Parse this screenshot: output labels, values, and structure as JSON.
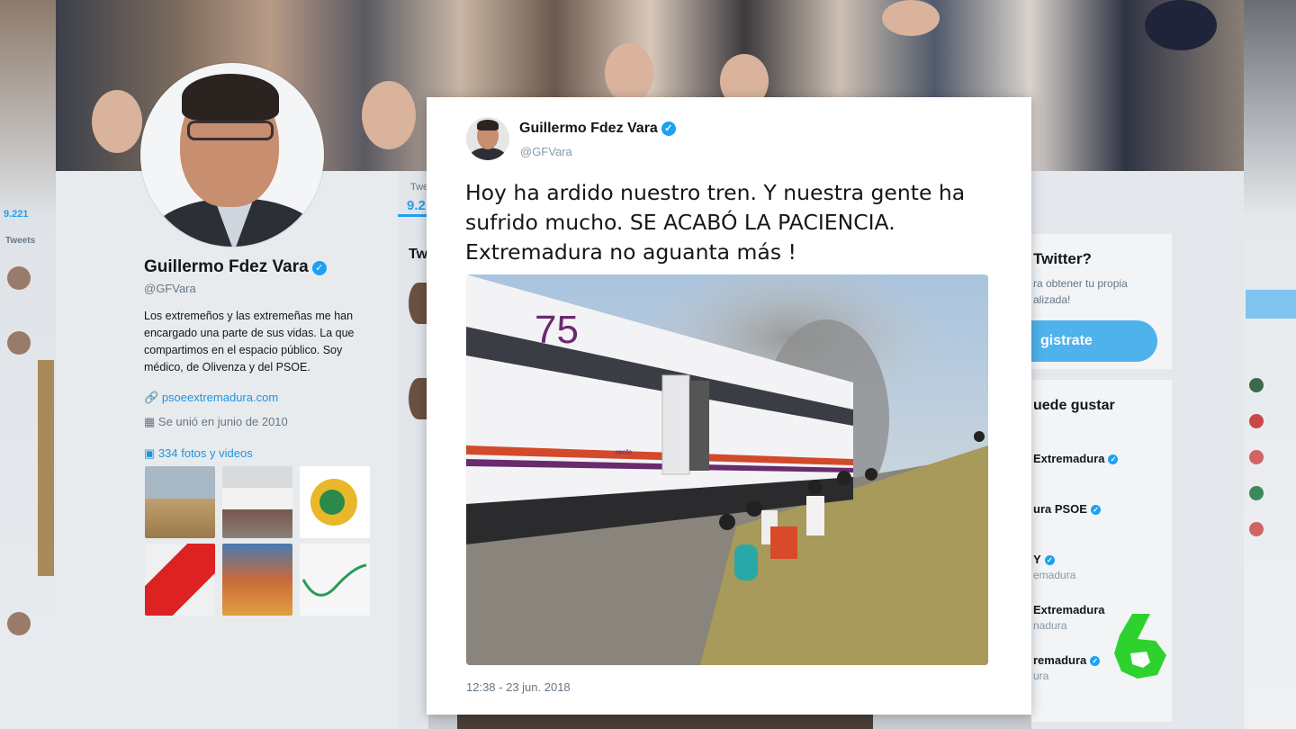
{
  "profile": {
    "name": "Guillermo Fdez Vara",
    "handle": "@GFVara",
    "bio": "Los extremeños y las extremeñas me han encargado una parte de sus vidas. La que compartimos en el espacio público. Soy médico, de Olivenza y del PSOE.",
    "website": "psoeextremadura.com",
    "joined": "Se unió en junio de 2010",
    "media_count": "334 fotos y videos",
    "link_icon": "link-icon",
    "calendar_icon": "calendar-icon",
    "media_icon": "photo-icon"
  },
  "background_fragments": {
    "tab_partial": "Twe",
    "stat_partial": "9.2",
    "left_tab": "Tweets",
    "left_stat": "9.221",
    "mid_header": "Tw",
    "signup_title": "Twitter?",
    "signup_text_line1": "ra obtener tu propia",
    "signup_text_line2": "alizada!",
    "signup_button": "gistrate",
    "suggest_title": "uede gustar",
    "suggestions": [
      {
        "name": "Extremadura",
        "sub": ""
      },
      {
        "name": "ura PSOE",
        "sub": ""
      },
      {
        "name": "Y",
        "sub": "emadura"
      },
      {
        "name": "Extremadura",
        "sub": "nadura"
      },
      {
        "name": "remadura",
        "sub": "ura"
      }
    ]
  },
  "tweet": {
    "author_name": "Guillermo Fdez Vara",
    "author_handle": "@GFVara",
    "text": "Hoy ha ardido nuestro tren. Y nuestra gente ha sufrido mucho. SE ACABÓ LA PACIENCIA. Extremadura no aguanta más !",
    "media_train_number": "75",
    "media_train_brand": "renfe",
    "timestamp": "12:38 - 23 jun. 2018",
    "verified_icon": "verified-badge-icon"
  },
  "broadcast": {
    "logo": "laSexta-6-logo"
  },
  "colors": {
    "twitter_blue": "#1da1f2",
    "link_blue": "#1b95e0",
    "text_primary": "#14171a",
    "text_secondary": "#657786",
    "logo_green": "#2fd12f"
  }
}
